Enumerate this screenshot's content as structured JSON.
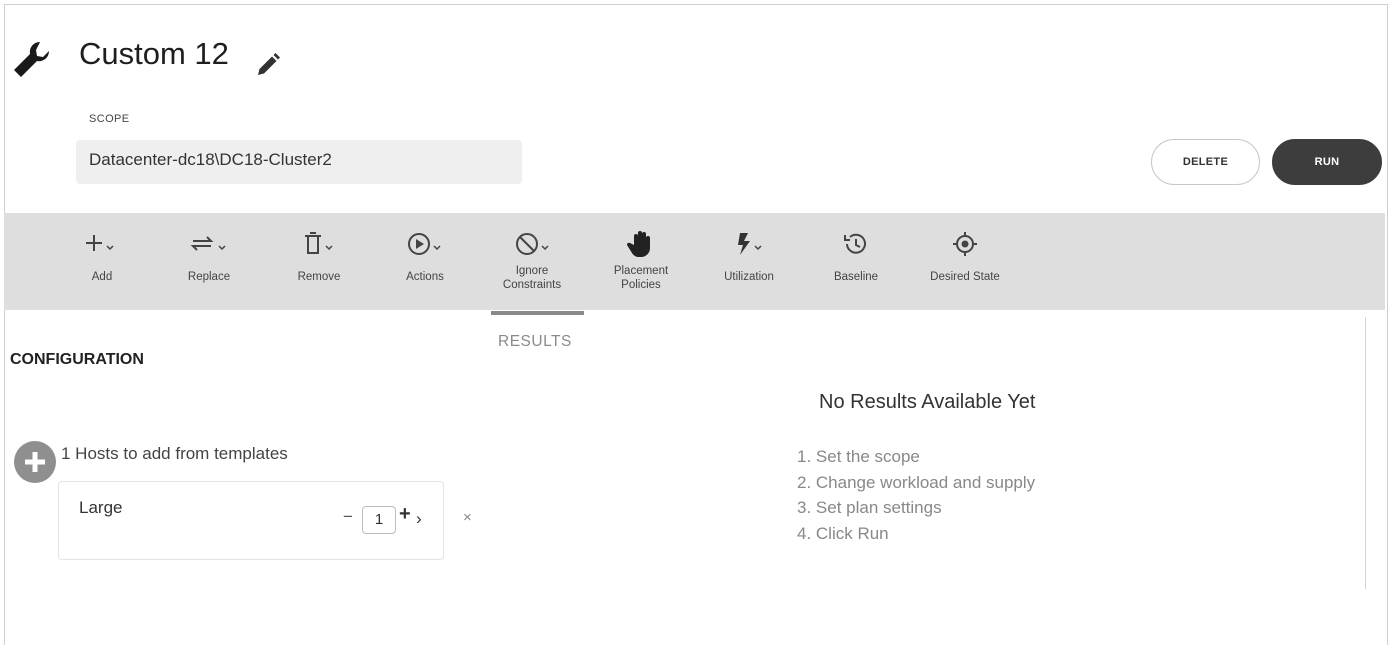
{
  "plan": {
    "title": "Custom 12",
    "scope_label": "SCOPE",
    "scope_value": "Datacenter-dc18\\DC18-Cluster2"
  },
  "buttons": {
    "delete": "DELETE",
    "run": "RUN"
  },
  "toolbar": {
    "items": [
      {
        "label": "Add",
        "icon": "plus-icon"
      },
      {
        "label": "Replace",
        "icon": "replace-arrows-icon"
      },
      {
        "label": "Remove",
        "icon": "trash-icon"
      },
      {
        "label": "Actions",
        "icon": "play-circle-icon"
      },
      {
        "label": "Ignore Constraints",
        "line1": "Ignore",
        "line2": "Constraints",
        "icon": "ban-icon"
      },
      {
        "label": "Placement Policies",
        "line1": "Placement",
        "line2": "Policies",
        "icon": "hand-icon"
      },
      {
        "label": "Utilization",
        "icon": "lightning-icon"
      },
      {
        "label": "Baseline",
        "icon": "history-clock-icon"
      },
      {
        "label": "Desired State",
        "icon": "target-icon"
      }
    ]
  },
  "configuration": {
    "title": "CONFIGURATION",
    "hosts_text": "1 Hosts to add from templates",
    "template": {
      "name": "Large",
      "minus": "−",
      "quantity": "1",
      "plus": "+",
      "chevron": "›",
      "remove": "×"
    }
  },
  "results": {
    "tab_label": "RESULTS",
    "empty_title": "No Results Available Yet",
    "steps": [
      "1. Set the scope",
      "2. Change workload and supply",
      "3. Set plan settings",
      "4. Click Run"
    ]
  }
}
